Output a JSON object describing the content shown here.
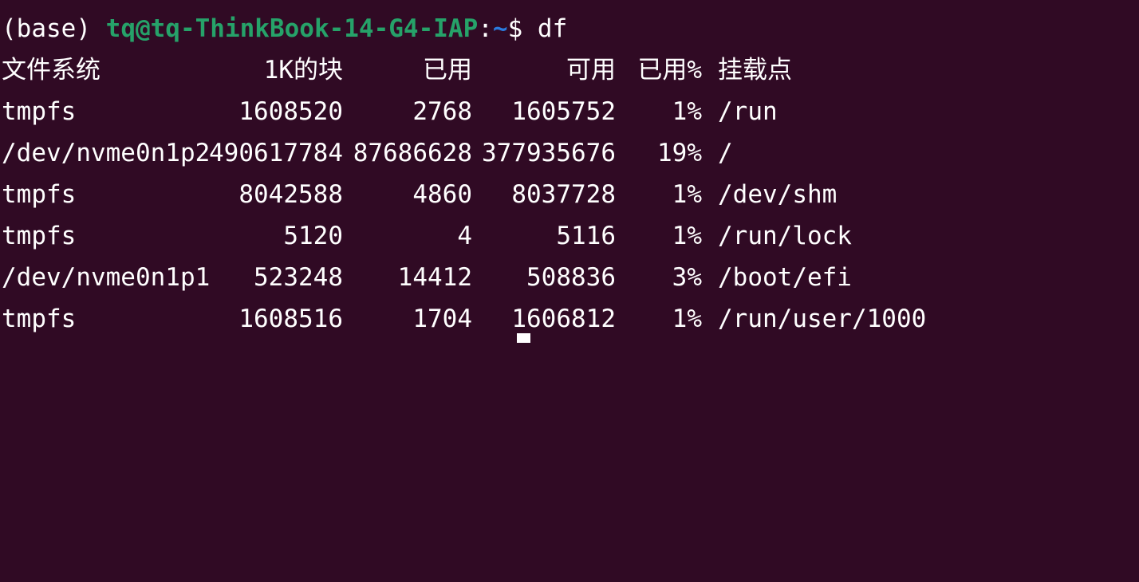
{
  "prompt": {
    "env": "(base) ",
    "user_host": "tq@tq-ThinkBook-14-G4-IAP",
    "colon": ":",
    "path": "~",
    "symbol": "$ ",
    "command": "df"
  },
  "table": {
    "headers": [
      "文件系统",
      "1K的块",
      "已用",
      "可用",
      "已用%",
      "挂载点"
    ],
    "rows": [
      [
        "tmpfs",
        "1608520",
        "2768",
        "1605752",
        "1%",
        "/run"
      ],
      [
        "/dev/nvme0n1p2",
        "490617784",
        "87686628",
        "377935676",
        "19%",
        "/"
      ],
      [
        "tmpfs",
        "8042588",
        "4860",
        "8037728",
        "1%",
        "/dev/shm"
      ],
      [
        "tmpfs",
        "5120",
        "4",
        "5116",
        "1%",
        "/run/lock"
      ],
      [
        "/dev/nvme0n1p1",
        "523248",
        "14412",
        "508836",
        "3%",
        "/boot/efi"
      ],
      [
        "tmpfs",
        "1608516",
        "1704",
        "1606812",
        "1%",
        "/run/user/1000"
      ]
    ]
  },
  "colors": {
    "background": "#300a24",
    "prompt_user": "#26a269",
    "prompt_path": "#2a7bde",
    "text": "#ffffff"
  }
}
